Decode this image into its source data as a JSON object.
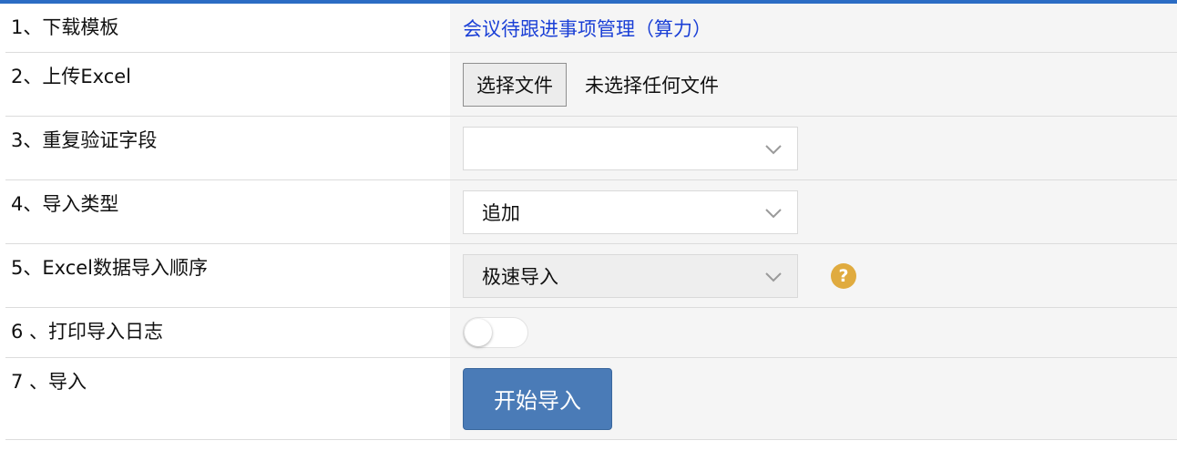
{
  "rows": [
    {
      "label": "1、下载模板",
      "link_text": "会议待跟进事项管理（算力）"
    },
    {
      "label": "2、上传Excel",
      "button_label": "选择文件",
      "status_text": "未选择任何文件"
    },
    {
      "label": "3、重复验证字段",
      "selected": ""
    },
    {
      "label": "4、导入类型",
      "selected": "追加"
    },
    {
      "label": "5、Excel数据导入顺序",
      "selected": "极速导入",
      "help_symbol": "?"
    },
    {
      "label": "6 、打印导入日志",
      "toggle_on": false
    },
    {
      "label": "7 、导入",
      "button_label": "开始导入"
    }
  ],
  "colors": {
    "top_bar": "#2b6cc4",
    "link": "#1a3fd6",
    "primary_button": "#4a7bb7",
    "help_icon": "#e0ab3f"
  },
  "icons": {
    "select_arrow": "chevron-down-icon",
    "help": "question-circle-icon"
  }
}
